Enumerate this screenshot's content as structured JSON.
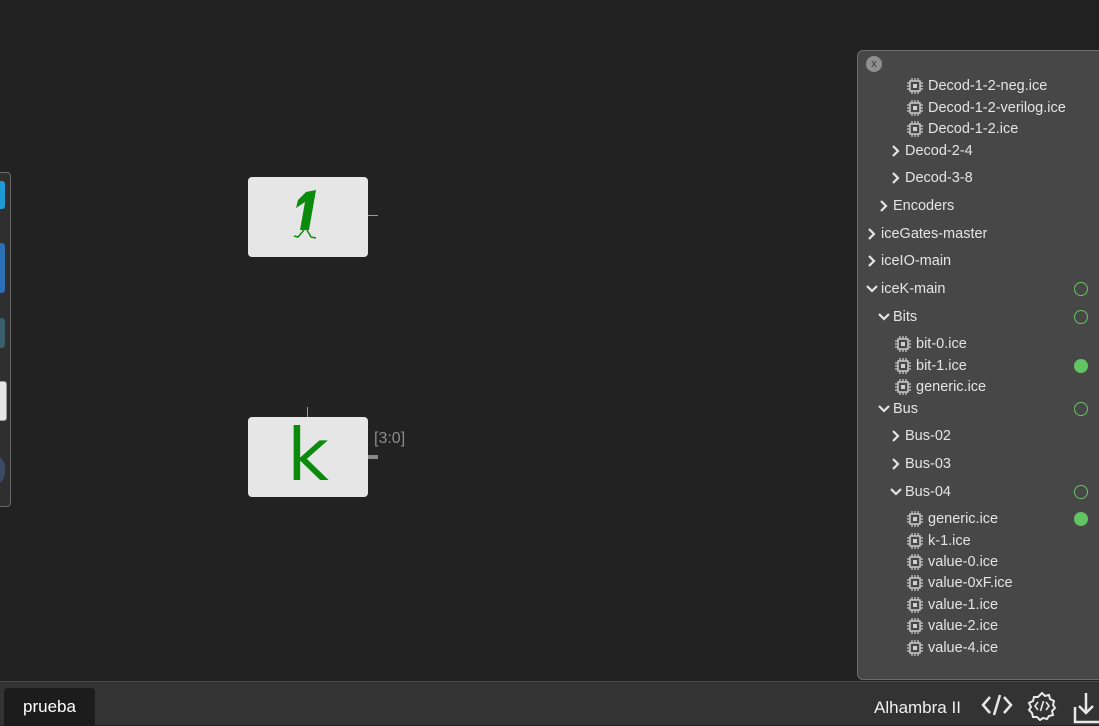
{
  "canvas": {
    "const_block_glyph": "1",
    "k_block_glyph": "k",
    "bus_label": "[3:0]"
  },
  "panel": {
    "close_label": "x",
    "items": [
      {
        "type": "file",
        "label": "Decod-1-2-neg.ice",
        "status": "none"
      },
      {
        "type": "file",
        "label": "Decod-1-2-verilog.ice",
        "status": "none"
      },
      {
        "type": "file",
        "label": "Decod-1-2.ice",
        "status": "none"
      },
      {
        "type": "folder",
        "expanded": false,
        "label": "Decod-2-4",
        "status": "none"
      },
      {
        "type": "folder",
        "expanded": false,
        "label": "Decod-3-8",
        "status": "none"
      },
      {
        "type": "folder",
        "expanded": false,
        "label": "Encoders",
        "status": "none"
      },
      {
        "type": "folder",
        "expanded": false,
        "label": "iceGates-master",
        "status": "none"
      },
      {
        "type": "folder",
        "expanded": false,
        "label": "iceIO-main",
        "status": "none"
      },
      {
        "type": "folder",
        "expanded": true,
        "label": "iceK-main",
        "status": "empty"
      },
      {
        "type": "folder",
        "expanded": true,
        "label": "Bits",
        "status": "empty"
      },
      {
        "type": "file",
        "label": "bit-0.ice",
        "status": "none"
      },
      {
        "type": "file",
        "label": "bit-1.ice",
        "status": "full"
      },
      {
        "type": "file",
        "label": "generic.ice",
        "status": "none"
      },
      {
        "type": "folder",
        "expanded": true,
        "label": "Bus",
        "status": "empty"
      },
      {
        "type": "folder",
        "expanded": false,
        "label": "Bus-02",
        "status": "none"
      },
      {
        "type": "folder",
        "expanded": false,
        "label": "Bus-03",
        "status": "none"
      },
      {
        "type": "folder",
        "expanded": true,
        "label": "Bus-04",
        "status": "empty"
      },
      {
        "type": "file",
        "label": "generic.ice",
        "status": "full"
      },
      {
        "type": "file",
        "label": "k-1.ice",
        "status": "none"
      },
      {
        "type": "file",
        "label": "value-0.ice",
        "status": "none"
      },
      {
        "type": "file",
        "label": "value-0xF.ice",
        "status": "none"
      },
      {
        "type": "file",
        "label": "value-1.ice",
        "status": "none"
      },
      {
        "type": "file",
        "label": "value-2.ice",
        "status": "none"
      },
      {
        "type": "file",
        "label": "value-4.ice",
        "status": "none"
      }
    ]
  },
  "bottom_bar": {
    "tab_label": "prueba",
    "board_label": "Alhambra II",
    "icons": [
      "code-icon",
      "gear-code-icon",
      "download-icon"
    ]
  },
  "colors": {
    "background": "#222222",
    "block": "#e6e6e6",
    "green": "#0c8a0c",
    "status_green": "#62c462"
  }
}
